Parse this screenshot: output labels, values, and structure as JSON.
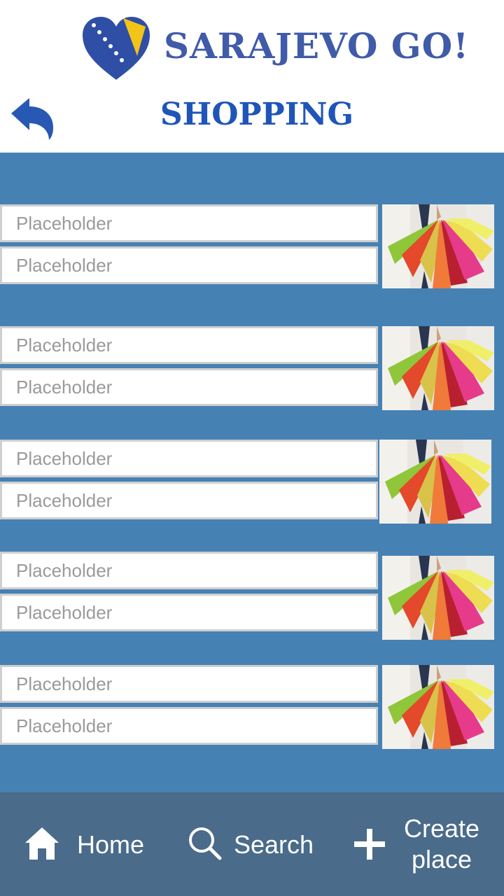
{
  "app": {
    "logo_text": "SARAJEVO GO!"
  },
  "header": {
    "title": "SHOPPING",
    "back_icon": "back-arrow-icon"
  },
  "colors": {
    "brand_blue": "#3f5ba9",
    "title_blue": "#1f55b8",
    "content_bg": "#4681b4",
    "footer_bg": "#4a6b8a"
  },
  "places": [
    {
      "name_placeholder": "Placeholder",
      "detail_placeholder": "Placeholder",
      "image": "shopping-bags-image"
    },
    {
      "name_placeholder": "Placeholder",
      "detail_placeholder": "Placeholder",
      "image": "shopping-bags-image"
    },
    {
      "name_placeholder": "Placeholder",
      "detail_placeholder": "Placeholder",
      "image": "shopping-bags-image"
    },
    {
      "name_placeholder": "Placeholder",
      "detail_placeholder": "Placeholder",
      "image": "shopping-bags-image"
    },
    {
      "name_placeholder": "Placeholder",
      "detail_placeholder": "Placeholder",
      "image": "shopping-bags-image"
    }
  ],
  "nav": {
    "home": {
      "label": "Home",
      "icon": "home-icon"
    },
    "search": {
      "label": "Search",
      "icon": "search-icon"
    },
    "create": {
      "label": "Create place",
      "icon": "plus-icon"
    }
  }
}
